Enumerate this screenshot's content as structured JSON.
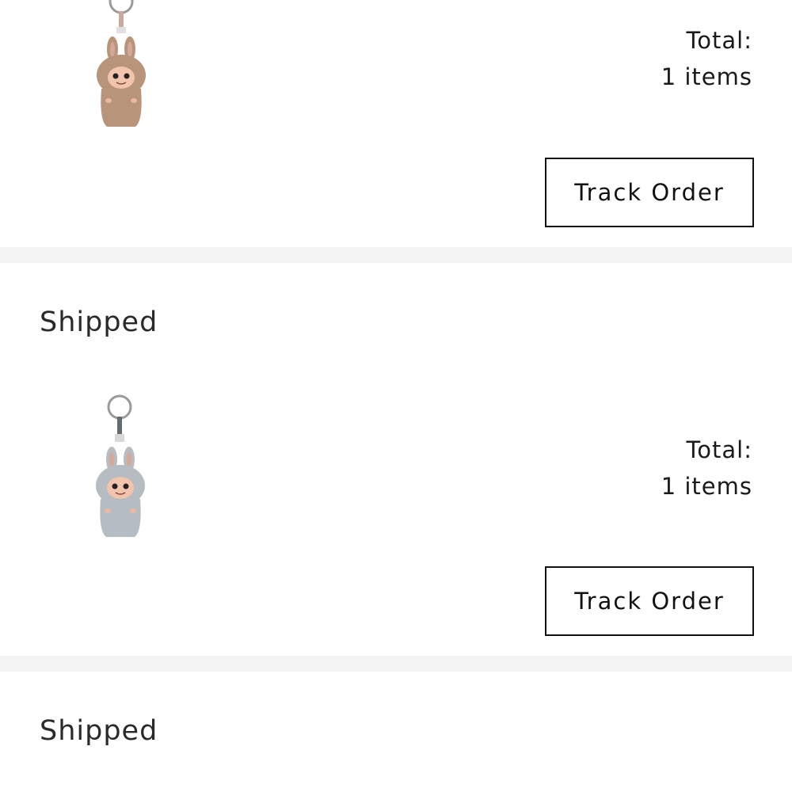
{
  "orders": [
    {
      "status": "",
      "total_label": "Total:",
      "items_count": "1 items",
      "track_label": "Track Order",
      "product": {
        "icon": "plush-keychain-brown",
        "fur_color": "#b8957a"
      }
    },
    {
      "status": "Shipped",
      "total_label": "Total:",
      "items_count": "1 items",
      "track_label": "Track Order",
      "product": {
        "icon": "plush-keychain-gray",
        "fur_color": "#b5bcc2"
      }
    },
    {
      "status": "Shipped"
    }
  ],
  "colors": {
    "divider": "#f3f3f3",
    "button_border": "#111111",
    "text": "#1a1a1a"
  }
}
